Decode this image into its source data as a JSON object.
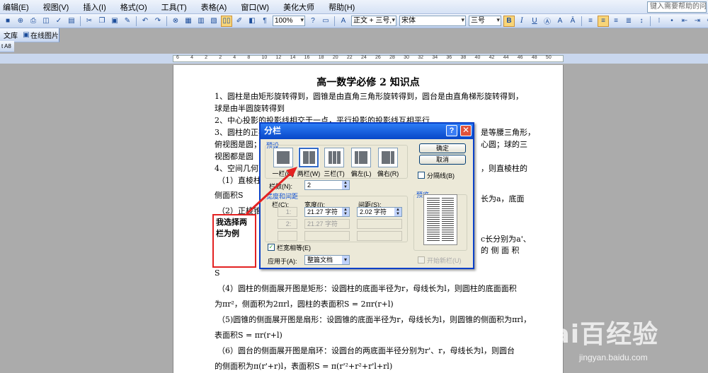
{
  "menu": {
    "items": [
      "编辑(E)",
      "视图(V)",
      "插入(I)",
      "格式(O)",
      "工具(T)",
      "表格(A)",
      "窗口(W)",
      "美化大师",
      "帮助(H)"
    ],
    "help_placeholder": "键入需要帮助的问题"
  },
  "toolbar": {
    "zoom": "100%",
    "style": "正文 + 三号,",
    "font": "宋体",
    "size": "三号",
    "bold": "B",
    "italic": "I",
    "underline": "U",
    "font_color": "A"
  },
  "toolbar2": {
    "lib_label": "文库",
    "online_pic_label": "在线图片"
  },
  "toolbar3": {
    "label": "t A8"
  },
  "ruler": {
    "labels": [
      "6",
      "4",
      "2",
      "2",
      "4",
      "8",
      "10",
      "12",
      "14",
      "16",
      "18",
      "20",
      "22",
      "24",
      "26",
      "28",
      "30",
      "32",
      "34",
      "36",
      "38",
      "40",
      "42",
      "44",
      "46",
      "48",
      "50"
    ]
  },
  "document": {
    "title": "高一数学必修 2 知识点",
    "lines": [
      "1、圆柱是由矩形旋转得到，圆锥是由直角三角形旋转得到，圆台是由直角梯形旋转得到，",
      "球是由半圆旋转得到",
      "2、中心投影的投影线相交于一点，平行投影的投影线互相平行",
      "3、圆柱的正视",
      "俯视图是圆；",
      "视图都是圆",
      "4、空间几何",
      "（1）直棱柱的",
      "侧面积S",
      "（2）正棱锥",
      "S",
      "（4）圆柱的侧面展开图是矩形：设圆柱的底面半径为r，母线长为l，则圆柱的底面面积",
      "为πr²，侧面积为2πrl，圆柱的表面积S = 2πr(r+l)",
      "（5)圆锥的侧面展开图是扇形：设圆锥的底面半径为r，母线长为l，则圆锥的侧面积为πrl，",
      "表面积S = πr(r+l)",
      "（6）圆台的侧面展开图是扇环：设圆台的两底面半径分别为r'、r，母线长为l，则圆台",
      "的侧面积为π(r'+r)l，表面积S = π(r'²+r²+r'l+rl)"
    ],
    "right_fragments": [
      "是等腰三角形，",
      "心圆；球的三",
      "，则直棱柱的",
      "长为a，底面",
      "c长分别为a'、",
      "的 侧 面 积"
    ]
  },
  "dialog": {
    "title": "分栏",
    "help_label": "?",
    "close_label": "✕",
    "presets_label": "预设",
    "presets": [
      "一栏(O)",
      "两栏(W)",
      "三栏(T)",
      "偏左(L)",
      "偏右(R)"
    ],
    "ok_label": "确定",
    "cancel_label": "取消",
    "divider_label": "分隔线(B)",
    "num_cols_label": "栏数(N):",
    "num_cols_value": "2",
    "width_spacing_label": "宽度和间距",
    "col_header": "栏(C):",
    "width_header": "宽度(I):",
    "spacing_header": "间距(S):",
    "row1": {
      "col": "1:",
      "width": "21.27 字符",
      "spacing": "2.02 字符"
    },
    "row2": {
      "col": "2:",
      "width": "21.27 字符"
    },
    "equal_width_label": "栏宽相等(E)",
    "apply_to_label": "应用于(A):",
    "apply_to_value": "整篇文档",
    "preview_label": "预览",
    "new_col_label": "开始新栏(U)"
  },
  "annotation": {
    "text": "我选择两栏为例",
    "color": "#e32222"
  },
  "watermark": {
    "logo": "Bai百经验",
    "url": "jingyan.baidu.com"
  }
}
